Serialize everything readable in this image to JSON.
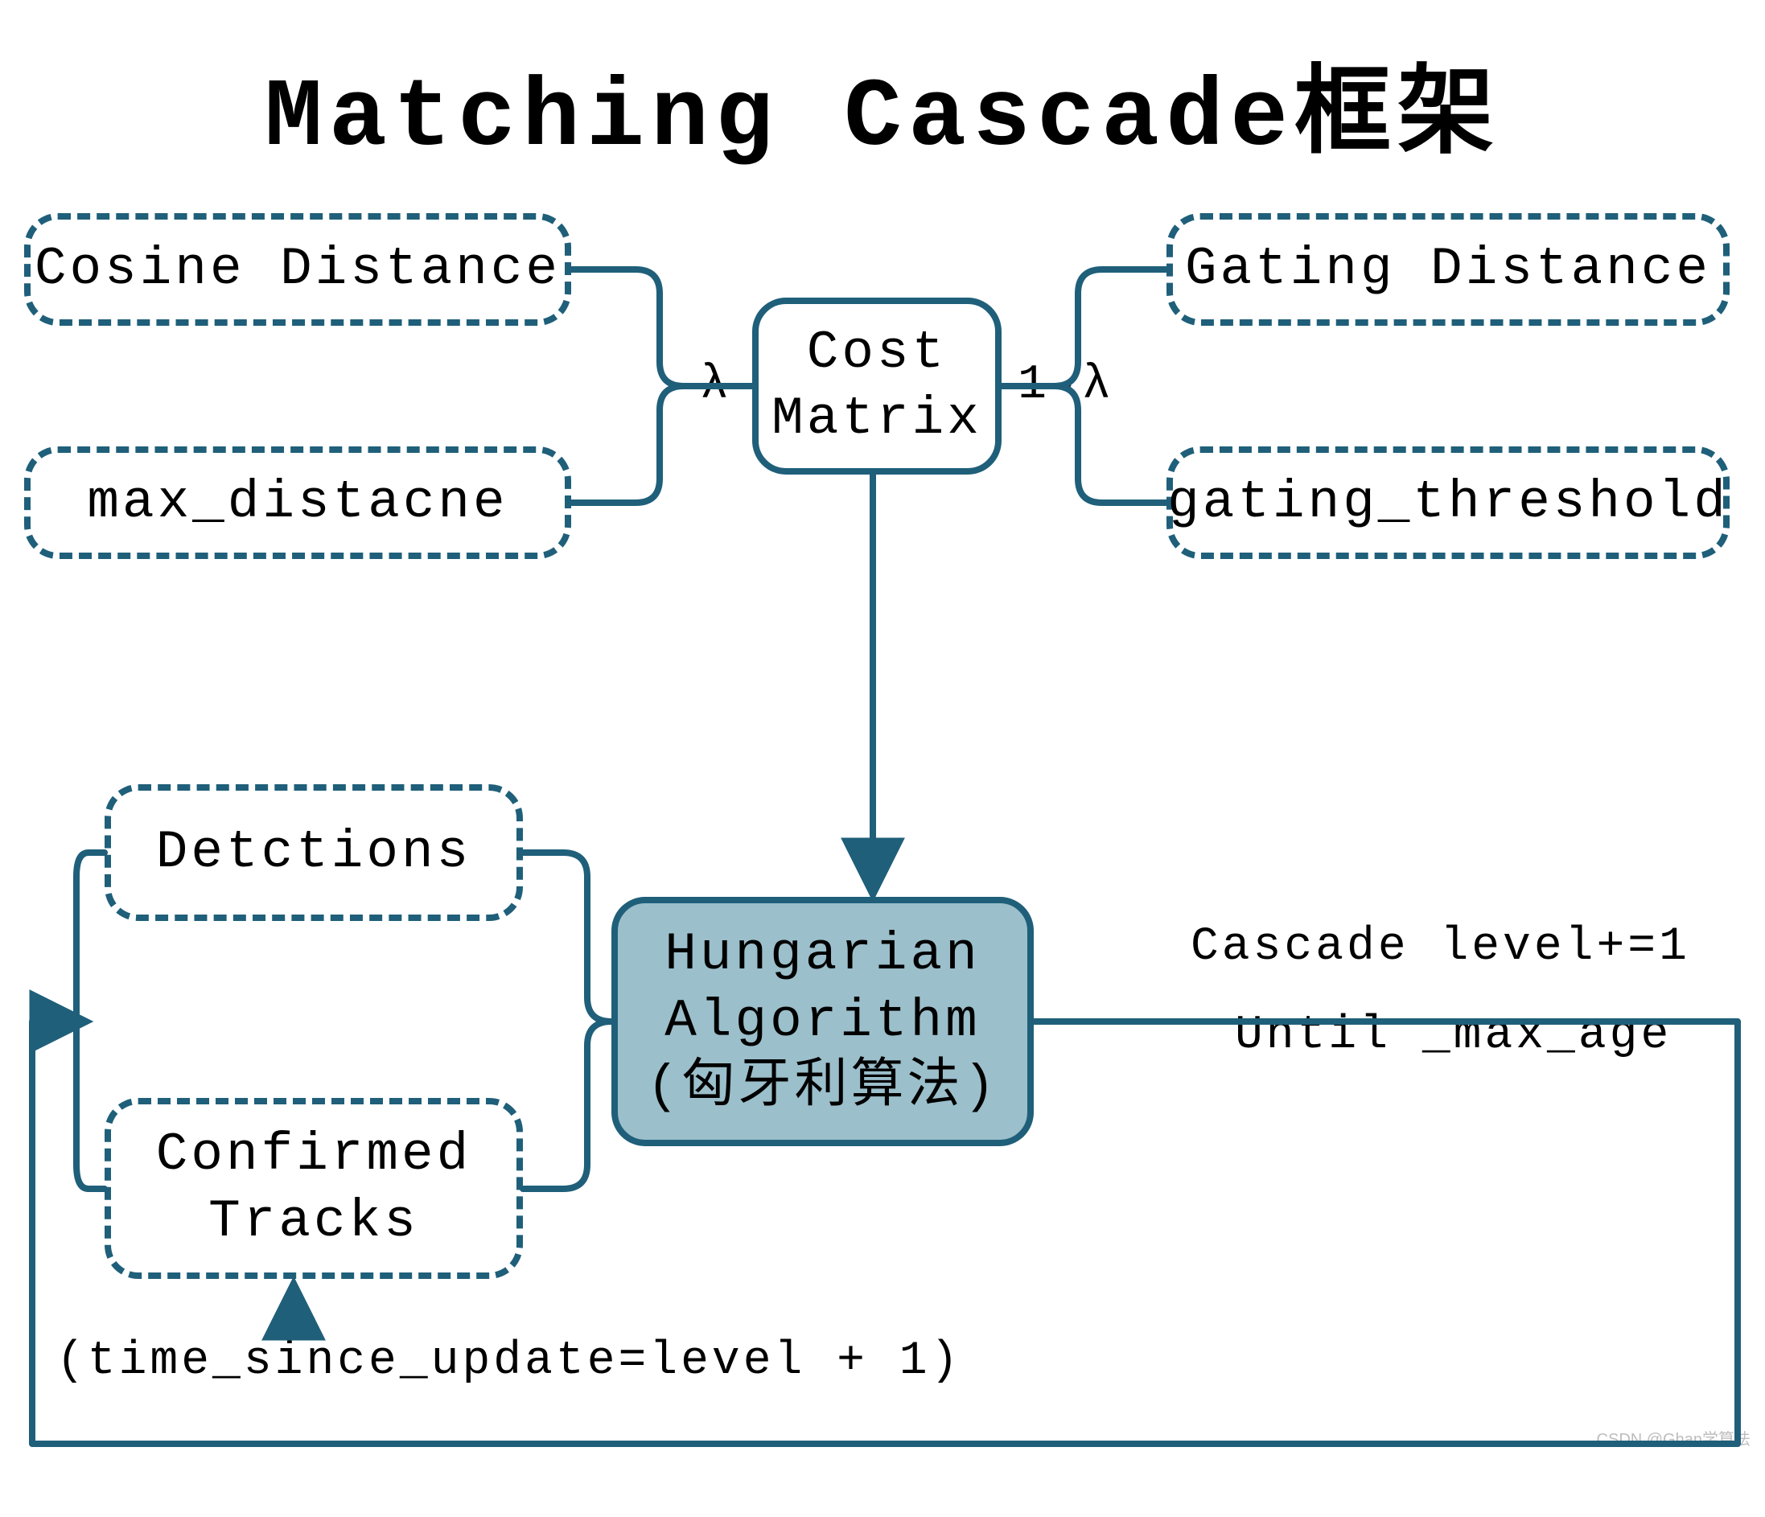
{
  "title": "Matching Cascade框架",
  "nodes": {
    "cosine": "Cosine Distance",
    "max_distance": "max_distacne",
    "gating": "Gating Distance",
    "gating_threshold": "gating_threshold",
    "cost_matrix": "Cost\nMatrix",
    "detections": "Detctions",
    "confirmed_tracks": "Confirmed\nTracks",
    "hungarian": "Hungarian\nAlgorithm\n(匈牙利算法)"
  },
  "edge_labels": {
    "lambda": "λ",
    "one_minus_lambda": "1-λ",
    "cascade_increment": "Cascade level+=1",
    "until_max_age": "Until _max_age",
    "time_since_update": "(time_since_update=level + 1)"
  },
  "watermark": "CSDN @Ghan学算法",
  "colors": {
    "stroke": "#1F5F7A",
    "fill_highlight": "#9BBFCB"
  }
}
